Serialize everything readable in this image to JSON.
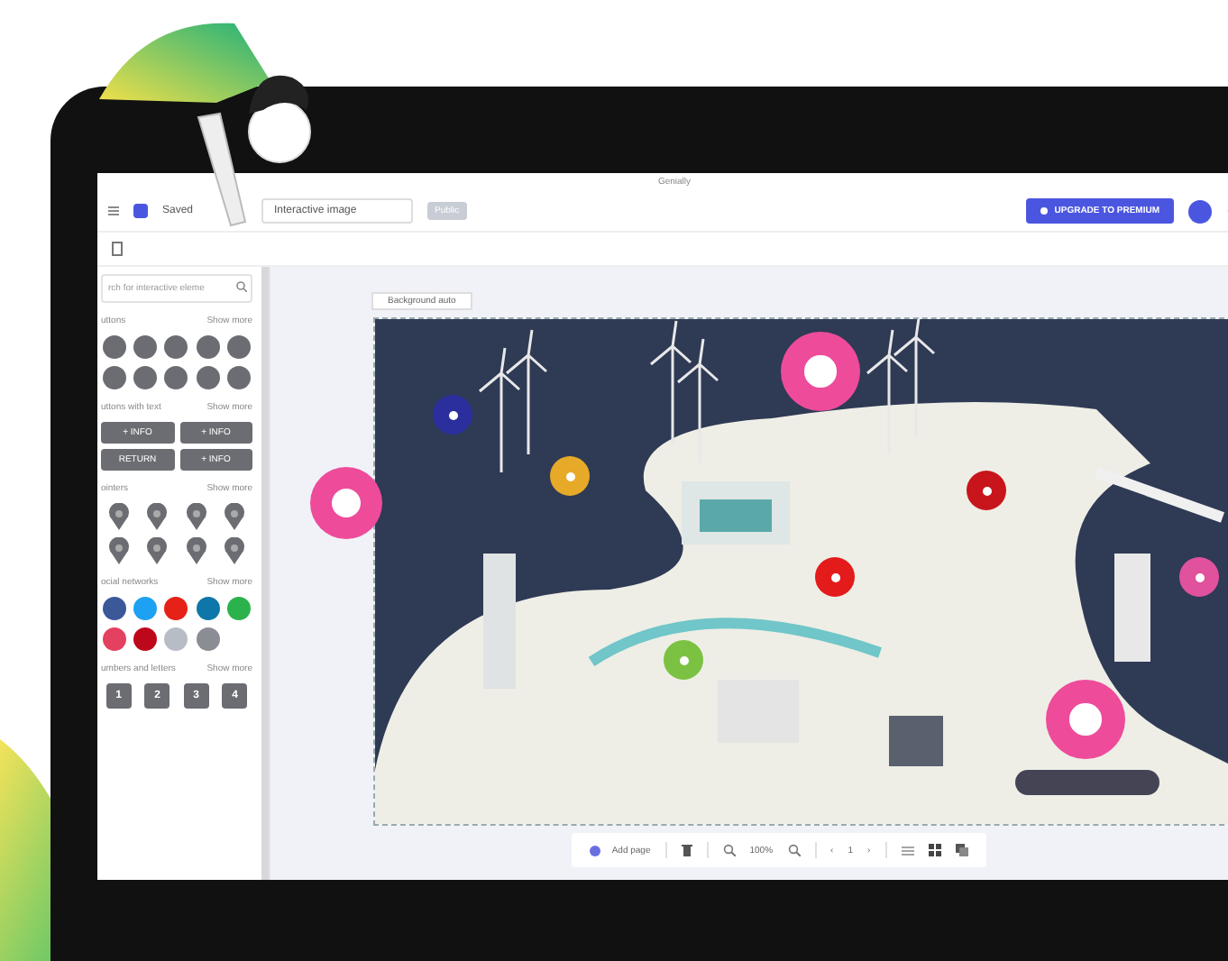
{
  "app": {
    "title": "Genially",
    "status": "Saved",
    "document_name": "Interactive image",
    "badge": "Public",
    "upgrade_button": "UPGRADE TO PREMIUM"
  },
  "sidebar": {
    "search": {
      "placeholder": "rch for interactive eleme"
    },
    "sections": [
      {
        "kind": "icons",
        "title": "uttons",
        "more": "Show more"
      },
      {
        "kind": "text-buttons",
        "title": "uttons with text",
        "more": "Show more",
        "buttons": [
          "+ INFO",
          "+ INFO",
          "RETURN",
          "+ INFO"
        ]
      },
      {
        "kind": "pins",
        "title": "ointers",
        "more": "Show more"
      },
      {
        "kind": "social",
        "title": "ocial networks",
        "more": "Show more",
        "items": [
          {
            "color": "#3b5998"
          },
          {
            "color": "#1da1f2"
          },
          {
            "color": "#e62117"
          },
          {
            "color": "#0e76a8"
          },
          {
            "color": "#2bb24c"
          },
          {
            "color": "#e4405f"
          },
          {
            "color": "#bd081c"
          },
          {
            "color": "#b8bcc4"
          },
          {
            "color": "#8a8d93"
          }
        ]
      },
      {
        "kind": "numbers",
        "title": "umbers and letters",
        "more": "Show more",
        "items": [
          "1",
          "2",
          "3",
          "4"
        ]
      }
    ]
  },
  "canvas": {
    "tag": "Background auto",
    "hotspots": [
      {
        "kind": "large",
        "color": "#ee4b9b"
      },
      {
        "kind": "large",
        "color": "#ee4b9b"
      },
      {
        "kind": "large",
        "color": "#ee4b9b"
      },
      {
        "kind": "small",
        "color": "#2b2f9e"
      },
      {
        "kind": "small",
        "color": "#e7a928"
      },
      {
        "kind": "small",
        "color": "#c8151b"
      },
      {
        "kind": "small",
        "color": "#e31b1b"
      },
      {
        "kind": "small",
        "color": "#7cc242"
      },
      {
        "kind": "small",
        "color": "#e0529c"
      }
    ]
  },
  "toolbar": {
    "add_page": "Add page",
    "zoom": "100%",
    "prev": "‹",
    "page": "1",
    "next": "›"
  }
}
